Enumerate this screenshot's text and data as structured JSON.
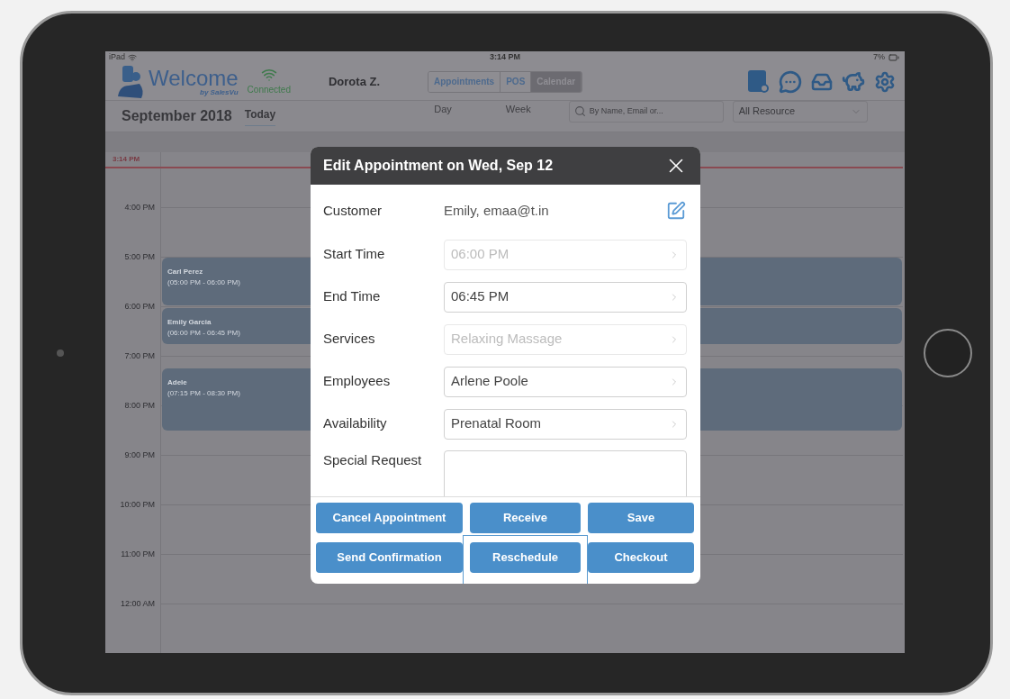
{
  "status_bar": {
    "device": "iPad",
    "time": "3:14 PM",
    "battery": "7%"
  },
  "header": {
    "brand": "Welcome",
    "brand_sub": "by SalesVu",
    "connection": "Connected",
    "user": "Dorota Z.",
    "tabs": [
      {
        "label": "Appointments",
        "selected": false
      },
      {
        "label": "POS",
        "selected": false
      },
      {
        "label": "Calendar",
        "selected": true
      }
    ]
  },
  "toolbar": {
    "month": "September 2018",
    "today": "Today",
    "views": [
      "Day",
      "Week"
    ],
    "search": {
      "placeholder": "By Name, Email or..."
    },
    "resource": "All Resource"
  },
  "calendar": {
    "now": "3:14 PM",
    "hours": [
      "4:00 PM",
      "5:00 PM",
      "6:00 PM",
      "7:00 PM",
      "8:00 PM",
      "9:00 PM",
      "10:00 PM",
      "11:00 PM",
      "12:00 AM"
    ],
    "events": [
      {
        "name": "Carl Perez",
        "time": "(05:00 PM - 06:00 PM)"
      },
      {
        "name": "Emily Garcia",
        "time": "(06:00 PM - 06:45 PM)"
      },
      {
        "name": "Adele",
        "time": "(07:15 PM - 08:30 PM)"
      }
    ]
  },
  "dialog": {
    "title": "Edit Appointment on Wed, Sep 12",
    "rows": [
      {
        "kind": "text",
        "label": "Customer",
        "value": "Emily, emaa@t.in"
      },
      {
        "kind": "select",
        "label": "Start Time",
        "value": "06:00 PM",
        "disabled": true
      },
      {
        "kind": "select",
        "label": "End Time",
        "value": "06:45 PM",
        "disabled": false
      },
      {
        "kind": "select",
        "label": "Services",
        "value": "Relaxing Massage",
        "disabled": true
      },
      {
        "kind": "select",
        "label": "Employees",
        "value": "Arlene Poole",
        "disabled": false
      },
      {
        "kind": "select",
        "label": "Availability",
        "value": "Prenatal Room",
        "disabled": false
      },
      {
        "kind": "textarea",
        "label": "Special Request"
      }
    ],
    "buttons": [
      {
        "label": "Cancel Appointment",
        "highlighted": false
      },
      {
        "label": "Receive",
        "highlighted": false
      },
      {
        "label": "Save",
        "highlighted": false
      },
      {
        "label": "Send Confirmation",
        "highlighted": false
      },
      {
        "label": "Reschedule",
        "highlighted": true
      },
      {
        "label": "Checkout",
        "highlighted": false
      }
    ]
  }
}
